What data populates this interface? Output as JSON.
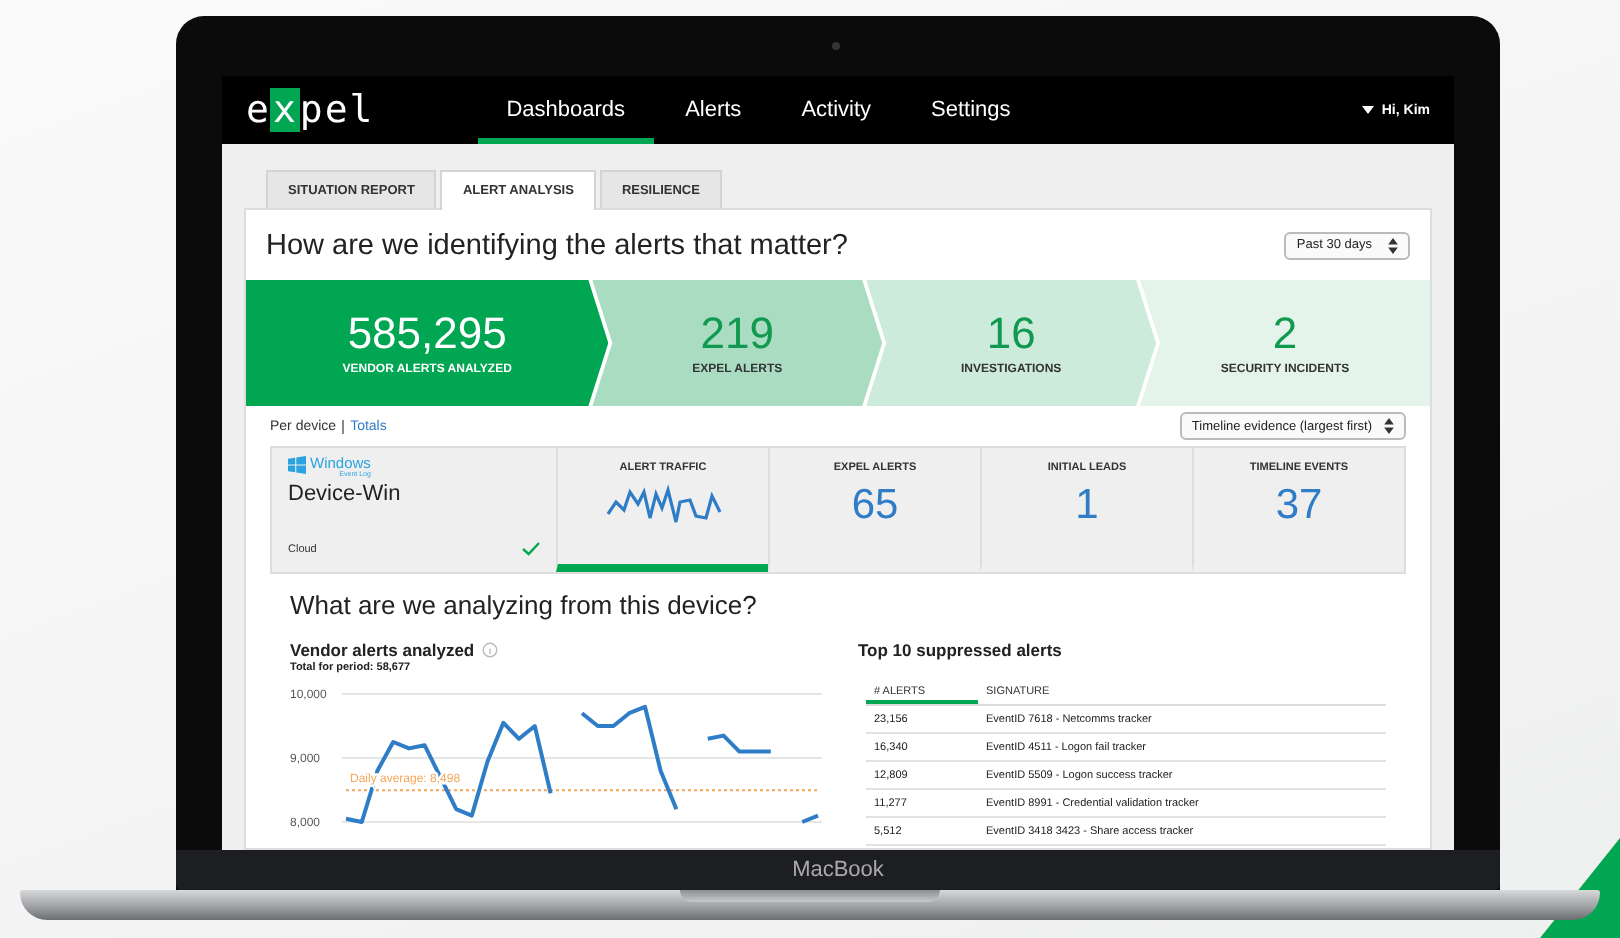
{
  "laptop": {
    "brand": "MacBook"
  },
  "nav": {
    "logo": {
      "before": "e",
      "boxed": "x",
      "after": "pel"
    },
    "items": [
      {
        "label": "Dashboards",
        "selected": true
      },
      {
        "label": "Alerts",
        "selected": false
      },
      {
        "label": "Activity",
        "selected": false
      },
      {
        "label": "Settings",
        "selected": false
      }
    ],
    "user": "Hi, Kim"
  },
  "tabs": [
    {
      "label": "SITUATION REPORT",
      "selected": false
    },
    {
      "label": "ALERT ANALYSIS",
      "selected": true
    },
    {
      "label": "RESILIENCE",
      "selected": false
    }
  ],
  "title": "How are we identifying the alerts that matter?",
  "period_select": {
    "value": "Past 30 days"
  },
  "funnel": [
    {
      "value": "585,295",
      "label": "VENDOR ALERTS ANALYZED",
      "color": "#00a651"
    },
    {
      "value": "219",
      "label": "EXPEL ALERTS",
      "color": "#a9dcc1"
    },
    {
      "value": "16",
      "label": "INVESTIGATIONS",
      "color": "#cdebdb"
    },
    {
      "value": "2",
      "label": "SECURITY INCIDENTS",
      "color": "#e4f4eb"
    }
  ],
  "view_toggle": [
    {
      "label": "Per device",
      "selected": true
    },
    {
      "label": "Totals",
      "selected": false
    }
  ],
  "sort_select": {
    "value": "Timeline evidence (largest first)"
  },
  "device": {
    "source": {
      "name": "Windows",
      "sub": "Event Log"
    },
    "name": "Device-Win",
    "location": "Cloud",
    "healthy": true,
    "metrics": [
      {
        "kind": "sparkline",
        "label": "ALERT TRAFFIC",
        "selected": true
      },
      {
        "kind": "number",
        "label": "EXPEL ALERTS",
        "value": "65",
        "selected": false
      },
      {
        "kind": "number",
        "label": "INITIAL LEADS",
        "value": "1",
        "selected": false
      },
      {
        "kind": "number",
        "label": "TIMELINE EVENTS",
        "value": "37",
        "selected": false
      }
    ]
  },
  "analysis": {
    "title": "What are we analyzing from this device?",
    "vendor_chart": {
      "title": "Vendor alerts analyzed",
      "subtitle": "Total for period: 58,677",
      "chart_data": {
        "type": "line",
        "ylim": [
          8000,
          10000
        ],
        "yticks": [
          {
            "value": 8000,
            "label": "8,000"
          },
          {
            "value": 9000,
            "label": "9,000"
          },
          {
            "value": 10000,
            "label": "10,000"
          }
        ],
        "series": [
          {
            "color": "#2f7cc7",
            "values": [
              8050,
              8000,
              8800,
              9250,
              9150,
              9200,
              8700,
              8200,
              8100,
              8950,
              9550,
              9300,
              9500,
              8450,
              null,
              9700,
              9500,
              9500,
              9700,
              9800,
              8800,
              8200,
              null,
              9300,
              9350,
              9100,
              9100,
              9100,
              null,
              8000,
              8100
            ]
          },
          {
            "name": "Daily average: 8,498",
            "color": "#f5a65b",
            "line_style": "dashed",
            "values": [
              8498,
              8498,
              8498,
              8498,
              8498,
              8498,
              8498,
              8498,
              8498,
              8498,
              8498,
              8498,
              8498,
              8498,
              8498,
              8498,
              8498,
              8498,
              8498,
              8498,
              8498,
              8498,
              8498,
              8498,
              8498,
              8498,
              8498,
              8498,
              8498,
              8498,
              8498
            ]
          }
        ]
      }
    },
    "suppressed": {
      "title": "Top 10 suppressed alerts",
      "columns": [
        {
          "label": "# ALERTS",
          "selected": true
        },
        {
          "label": "SIGNATURE",
          "selected": false
        }
      ],
      "rows": [
        [
          "23,156",
          "EventID 7618 - Netcomms tracker"
        ],
        [
          "16,340",
          "EventID 4511 - Logon fail tracker"
        ],
        [
          "12,809",
          "EventID 5509 - Logon success tracker"
        ],
        [
          "11,277",
          "EventID 8991 - Credential validation tracker"
        ],
        [
          "5,512",
          "EventID 3418 3423 - Share access tracker"
        ]
      ]
    }
  }
}
